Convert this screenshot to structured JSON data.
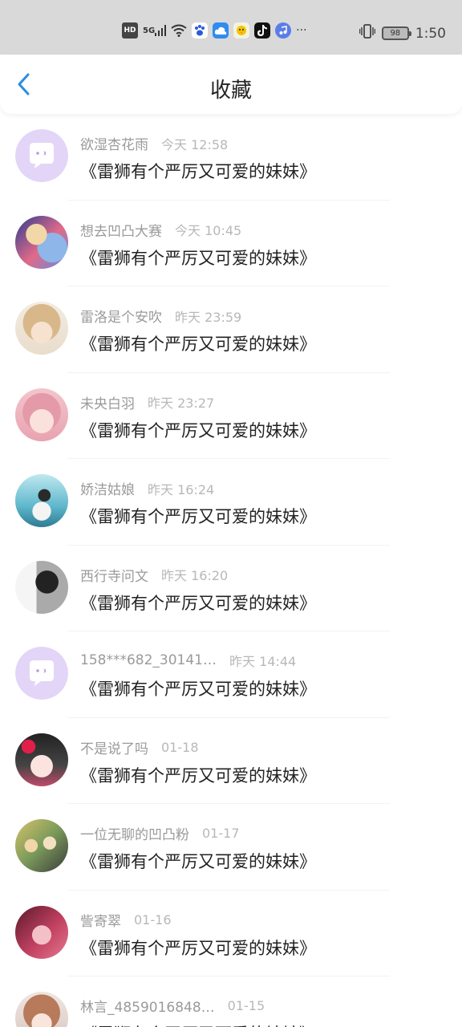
{
  "status_bar": {
    "hd": "HD",
    "signal": "5G",
    "more": "···",
    "battery": "98",
    "time": "1:50"
  },
  "header": {
    "title": "收藏"
  },
  "items": [
    {
      "user": "欲湿杏花雨",
      "time": "今天 12:58",
      "title": "《雷狮有个严厉又可爱的妹妹》",
      "avatar": "default"
    },
    {
      "user": "想去凹凸大赛",
      "time": "今天 10:45",
      "title": "《雷狮有个严厉又可爱的妹妹》",
      "avatar": "anime-blue"
    },
    {
      "user": "雷洛是个安吹",
      "time": "昨天 23:59",
      "title": "《雷狮有个严厉又可爱的妹妹》",
      "avatar": "anime-blond"
    },
    {
      "user": "未央白羽",
      "time": "昨天 23:27",
      "title": "《雷狮有个严厉又可爱的妹妹》",
      "avatar": "anime-pink"
    },
    {
      "user": "娇洁姑娘",
      "time": "昨天 16:24",
      "title": "《雷狮有个严厉又可爱的妹妹》",
      "avatar": "photo-teal"
    },
    {
      "user": "西行寺问文",
      "time": "昨天 16:20",
      "title": "《雷狮有个严厉又可爱的妹妹》",
      "avatar": "photo-bw"
    },
    {
      "user": "158***682_30141…",
      "time": "昨天 14:44",
      "title": "《雷狮有个严厉又可爱的妹妹》",
      "avatar": "default"
    },
    {
      "user": "不是说了吗",
      "time": "01-18",
      "title": "《雷狮有个严厉又可爱的妹妹》",
      "avatar": "anime-dark"
    },
    {
      "user": "一位无聊的凹凸粉",
      "time": "01-17",
      "title": "《雷狮有个严厉又可爱的妹妹》",
      "avatar": "anime-group"
    },
    {
      "user": "訾寄翠",
      "time": "01-16",
      "title": "《雷狮有个严厉又可爱的妹妹》",
      "avatar": "anime-red"
    },
    {
      "user": "林言_4859016848…",
      "time": "01-15",
      "title": "《雷狮有个严厉又可爱的妹妹》",
      "avatar": "anime-light"
    }
  ]
}
